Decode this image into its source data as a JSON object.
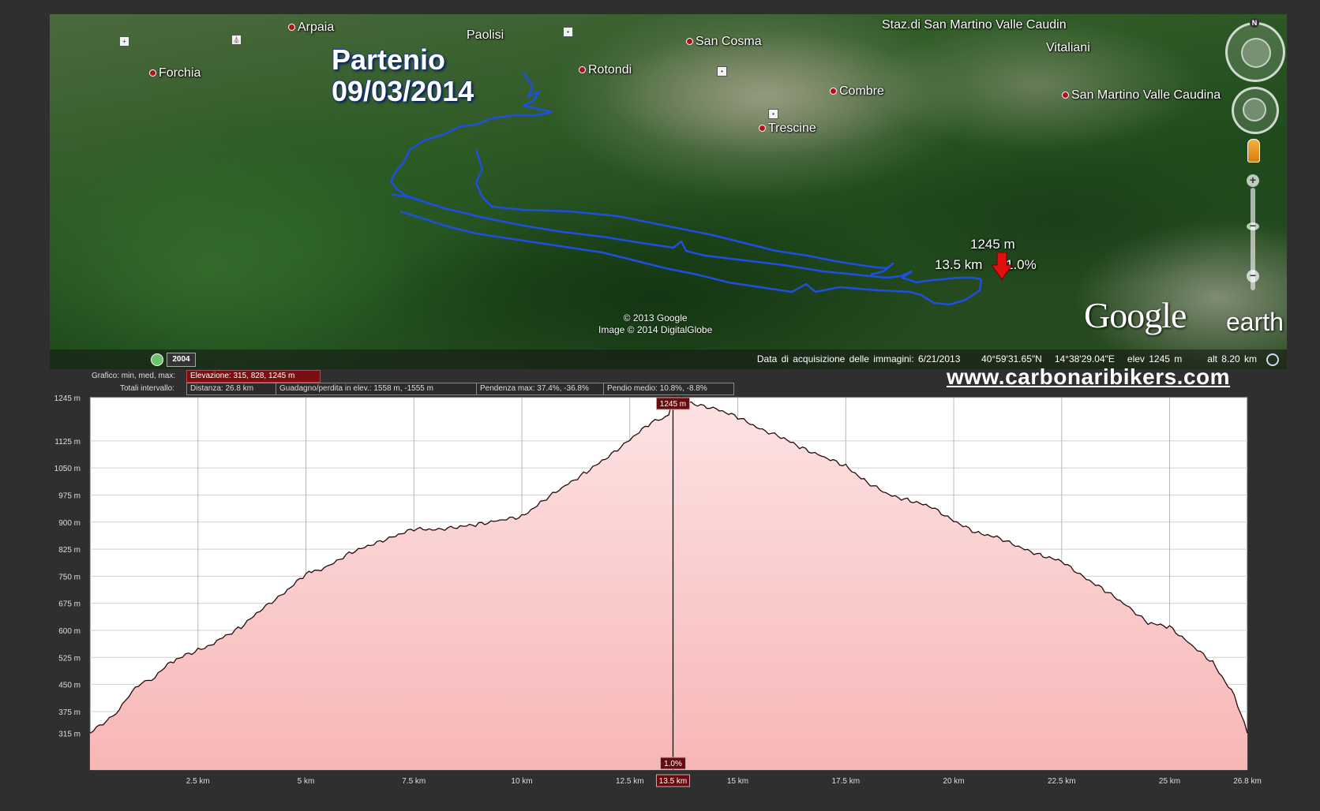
{
  "map": {
    "route_title_line1": "Partenio",
    "route_title_line2": "09/03/2014",
    "places": [
      {
        "name": "Arpaia"
      },
      {
        "name": "Paolisi"
      },
      {
        "name": "Forchia"
      },
      {
        "name": "Rotondi"
      },
      {
        "name": "San Cosma"
      },
      {
        "name": "Staz.di San Martino Valle Caudin"
      },
      {
        "name": "Vitaliani"
      },
      {
        "name": "Combre"
      },
      {
        "name": "Trescine"
      },
      {
        "name": "San Martino Valle Caudina"
      }
    ],
    "cursor": {
      "elevation": "1245 m",
      "distance": "13.5 km",
      "grade": "1.0%"
    },
    "track_color": "#1f4fe0",
    "marker_color": "#e01010",
    "credit_line1": "© 2013 Google",
    "credit_line2": "Image © 2014 DigitalGlobe",
    "logo_google": "Google",
    "logo_earth": "earth",
    "year": "2004",
    "status": {
      "acquisition": "Data di acquisizione delle immagini: 6/21/2013",
      "lat": "40°59'31.65\"N",
      "lon": "14°38'29.04\"E",
      "elev": "elev  1245 m",
      "alt": "alt   8.20 km"
    },
    "north": "N",
    "zoom_in": "+",
    "zoom_out": "−"
  },
  "profile": {
    "row1_label": "Grafico: min, med, max:",
    "row1_elev": "Elevazione: 315, 828, 1245 m",
    "row2_label": "Totali intervallo:",
    "distance": "Distanza: 26.8 km",
    "gain_loss": "Guadagno/perdita in elev.: 1558 m, -1555 m",
    "max_grade": "Pendenza max: 37.4%, -36.8%",
    "avg_grade": "Pendio medio: 10.8%, -8.8%"
  },
  "site_url": "www.carbonaribikers.com",
  "chart_data": {
    "type": "area",
    "fill_color": "#f7b6b6",
    "line_color": "#2a0a0a",
    "grid": true,
    "y_ticks": [
      "1245 m",
      "1125 m",
      "1050 m",
      "975 m",
      "900 m",
      "825 m",
      "750 m",
      "675 m",
      "600 m",
      "525 m",
      "450 m",
      "375 m",
      "315 m"
    ],
    "y_tick_values": [
      1245,
      1125,
      1050,
      975,
      900,
      825,
      750,
      675,
      600,
      525,
      450,
      375,
      315
    ],
    "x_ticks": [
      "2.5 km",
      "5 km",
      "7.5 km",
      "10 km",
      "12.5 km",
      "15 km",
      "17.5 km",
      "20 km",
      "22.5 km",
      "25 km",
      "26.8 km"
    ],
    "x_tick_values": [
      2.5,
      5,
      7.5,
      10,
      12.5,
      15,
      17.5,
      20,
      22.5,
      25,
      26.8
    ],
    "xlim": [
      0,
      26.8
    ],
    "ylim": [
      213,
      1245
    ],
    "cursor_x": 13.5,
    "cursor_top_label": "1245 m",
    "cursor_grade_label": "1.0%",
    "cursor_x_label": "13.5 km",
    "x": [
      0,
      0.6,
      0.9,
      1.2,
      1.5,
      1.8,
      2.0,
      2.5,
      2.8,
      3.0,
      3.5,
      4.0,
      4.5,
      5.0,
      5.2,
      5.5,
      6.0,
      6.5,
      7.0,
      7.5,
      8.0,
      8.5,
      9.0,
      9.5,
      10.0,
      10.5,
      11.0,
      11.5,
      12.0,
      12.5,
      13.0,
      13.4,
      13.5,
      13.7,
      14.0,
      14.5,
      15.0,
      15.5,
      16.0,
      16.5,
      17.0,
      17.5,
      18.0,
      18.5,
      19.0,
      19.5,
      20.0,
      20.5,
      21.0,
      21.5,
      22.0,
      22.5,
      23.0,
      23.5,
      24.0,
      24.5,
      25.0,
      25.5,
      26.0,
      26.5,
      26.8
    ],
    "y": [
      315,
      370,
      420,
      455,
      470,
      505,
      520,
      545,
      560,
      575,
      610,
      660,
      705,
      755,
      765,
      775,
      815,
      835,
      860,
      880,
      880,
      885,
      895,
      905,
      915,
      960,
      1000,
      1040,
      1080,
      1130,
      1175,
      1195,
      1245,
      1245,
      1225,
      1215,
      1190,
      1160,
      1135,
      1105,
      1080,
      1055,
      1010,
      975,
      960,
      940,
      905,
      870,
      860,
      830,
      810,
      790,
      750,
      710,
      670,
      620,
      610,
      560,
      510,
      420,
      315
    ]
  }
}
